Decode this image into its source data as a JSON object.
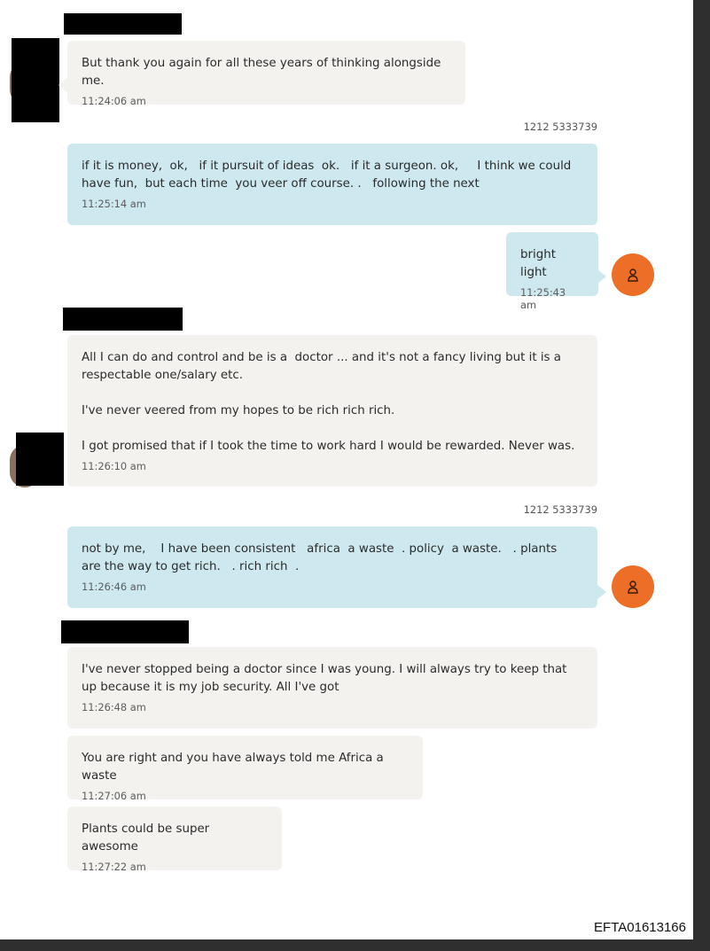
{
  "messages": [
    {
      "text": "But thank you again for all these years of thinking alongside me.",
      "time": "11:24:06 am"
    },
    {
      "sender": "1212 5333739",
      "text": "if it is money,  ok,   if it pursuit of ideas  ok.   if it a surgeon. ok,     I think we could have fun,  but each time  you veer off course. .   following the next",
      "time": "11:25:14 am"
    },
    {
      "text": "bright light",
      "time": "11:25:43 am"
    },
    {
      "text": "All I can do and control and be is a  doctor ... and it's not a fancy living but it is a respectable one/salary etc.\n\nI've never veered from my hopes to be rich rich rich.\n\nI got promised that if I took the time to work hard I would be rewarded. Never was.",
      "time": "11:26:10 am"
    },
    {
      "sender": "1212 5333739",
      "text": "not by me,    I have been consistent   africa  a waste  . policy  a waste.   . plants  are the way to get rich.   . rich rich  .",
      "time": "11:26:46 am"
    },
    {
      "text": "I've never stopped being a doctor since I was young. I will always try to keep that up because it is my job security. All I've got",
      "time": "11:26:48 am"
    },
    {
      "text": "You are right and you have always told me Africa a waste",
      "time": "11:27:06 am"
    },
    {
      "text": "Plants could be super awesome",
      "time": "11:27:22 am"
    }
  ],
  "footer": {
    "doc_id": "EFTA01613166"
  },
  "colors": {
    "incoming_bubble": "#f3f2ef",
    "outgoing_bubble": "#cde8ee",
    "avatar": "#ec6e27",
    "redaction": "#000000"
  },
  "icons": {
    "avatar": "user-icon"
  }
}
